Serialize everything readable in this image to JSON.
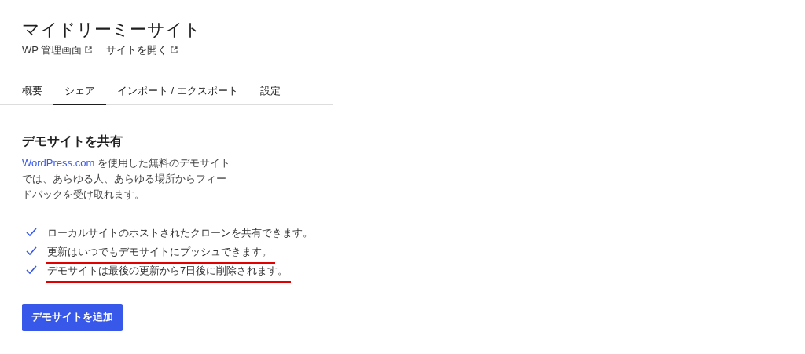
{
  "site": {
    "title": "マイドリーミーサイト",
    "links": [
      {
        "label": "WP 管理画面"
      },
      {
        "label": "サイトを開く"
      }
    ]
  },
  "tabs": [
    {
      "label": "概要",
      "selected": false
    },
    {
      "label": "シェア",
      "selected": true
    },
    {
      "label": "インポート / エクスポート",
      "selected": false
    },
    {
      "label": "設定",
      "selected": false
    }
  ],
  "section": {
    "heading": "デモサイトを共有",
    "description": {
      "link": "WordPress.com",
      "text": " を使用した無料のデモサイトでは、あらゆる人、あらゆる場所からフィードバックを受け取れます。"
    },
    "features": [
      {
        "text": "ローカルサイトのホストされたクローンを共有できます。",
        "underlined": false
      },
      {
        "text": "更新はいつでもデモサイトにプッシュできます。",
        "underlined": true
      },
      {
        "text": "デモサイトは最後の更新から7日後に削除されます。",
        "underlined": true
      }
    ],
    "button": "デモサイトを追加"
  }
}
